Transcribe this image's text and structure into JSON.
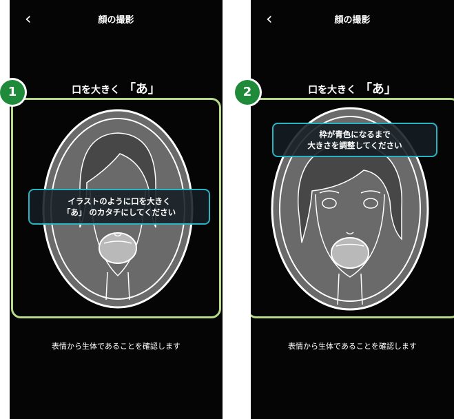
{
  "screens": [
    {
      "title": "顔の撮影",
      "instruction_prefix": "口を大きく",
      "instruction_quote": "「あ」",
      "hint_line1": "イラストのように口を大きく",
      "hint_line2": "「あ」 のカタチにしてください",
      "footer": "表情から生体であることを確認します",
      "step": "1"
    },
    {
      "title": "顔の撮影",
      "instruction_prefix": "口を大きく",
      "instruction_quote": "「あ」",
      "hint_line1": "枠が青色になるまで",
      "hint_line2": "大きさを調整してください",
      "footer": "表情から生体であることを確認します",
      "step": "2"
    }
  ],
  "icons": {
    "back": "chevron-left-icon"
  },
  "colors": {
    "frame": "#b7d98a",
    "hint_border": "#2bb3c4",
    "badge": "#1e8a3a"
  }
}
